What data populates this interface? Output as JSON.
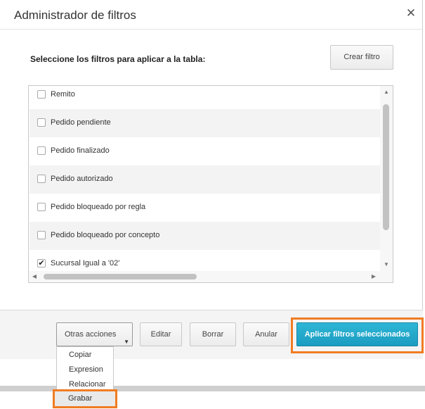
{
  "dialog": {
    "title": "Administrador de filtros",
    "close_icon": "close-icon",
    "instruction": "Seleccione los filtros para aplicar a la tabla:",
    "create_button": "Crear filtro"
  },
  "filters": [
    {
      "label": "Remito",
      "checked": false
    },
    {
      "label": "Pedido pendiente",
      "checked": false
    },
    {
      "label": "Pedido finalizado",
      "checked": false
    },
    {
      "label": "Pedido autorizado",
      "checked": false
    },
    {
      "label": "Pedido bloqueado por regla",
      "checked": false
    },
    {
      "label": "Pedido bloqueado por concepto",
      "checked": false
    },
    {
      "label": "Sucursal Igual a '02'",
      "checked": true
    }
  ],
  "footer": {
    "other_actions": "Otras acciones",
    "edit": "Editar",
    "delete": "Borrar",
    "cancel": "Anular",
    "apply": "Aplicar filtros seleccionados"
  },
  "other_actions_menu": [
    "Copiar",
    "Expresion",
    "Relacionar",
    "Grabar"
  ],
  "colors": {
    "accent": "#1a9cc0",
    "highlight": "#f07c22"
  }
}
